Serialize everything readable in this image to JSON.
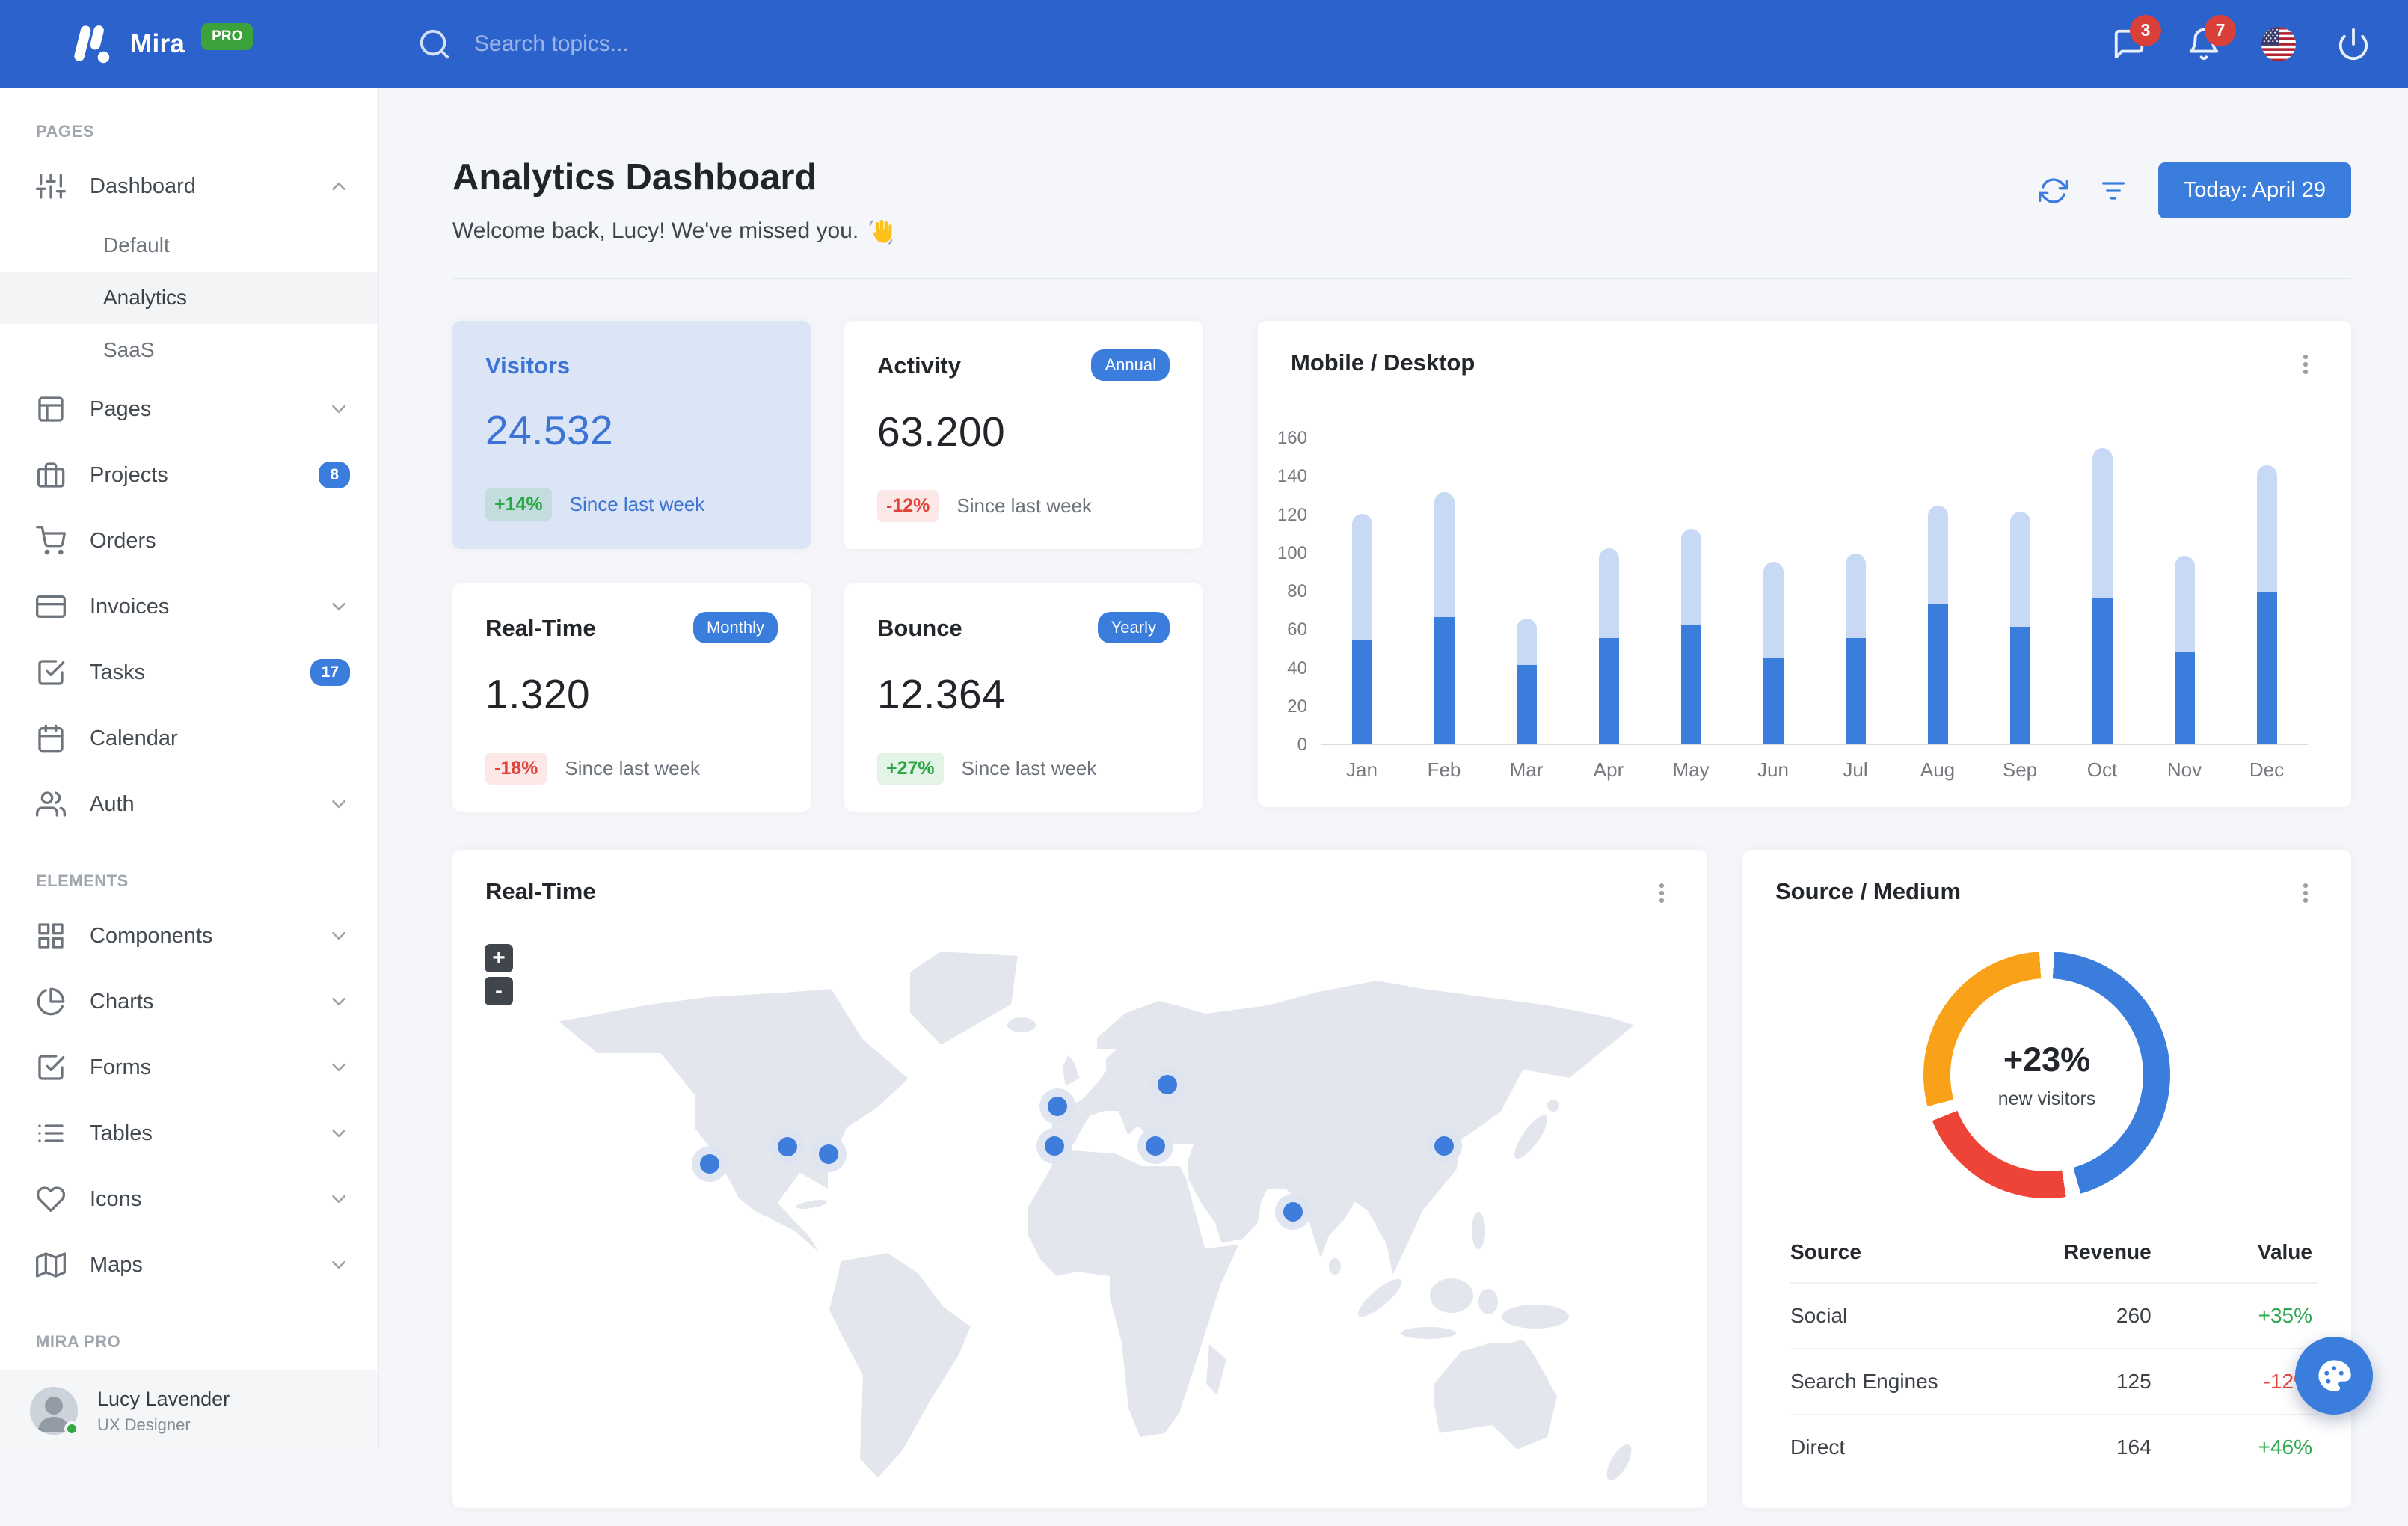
{
  "colors": {
    "navbar": "#2C62CB",
    "primary": "#3B7DDD",
    "success": "#2FA84F",
    "danger": "#E5473C",
    "warning_orange": "#F9A119",
    "bar_light": "#C7D9F4",
    "highlight_card_bg": "#DBE5F5",
    "badge_red": "#D9403A",
    "pro_green": "#3CA23C"
  },
  "navbar": {
    "brand": "Mira",
    "brand_badge": "PRO",
    "search_placeholder": "Search topics...",
    "icons": [
      {
        "name": "messages",
        "badge": "3"
      },
      {
        "name": "notifications",
        "badge": "7"
      },
      {
        "name": "language-us-flag"
      },
      {
        "name": "power"
      }
    ]
  },
  "sidebar": {
    "sections": [
      {
        "label": "PAGES",
        "items": [
          {
            "label": "Dashboard",
            "icon": "sliders",
            "expanded": true,
            "children": [
              "Default",
              "Analytics",
              "SaaS"
            ],
            "active_child": "Analytics"
          },
          {
            "label": "Pages",
            "icon": "layout",
            "chevron": true
          },
          {
            "label": "Projects",
            "icon": "briefcase",
            "badge": "8"
          },
          {
            "label": "Orders",
            "icon": "shopping-cart"
          },
          {
            "label": "Invoices",
            "icon": "credit-card",
            "chevron": true
          },
          {
            "label": "Tasks",
            "icon": "check-square",
            "badge": "17"
          },
          {
            "label": "Calendar",
            "icon": "calendar"
          },
          {
            "label": "Auth",
            "icon": "users",
            "chevron": true
          }
        ]
      },
      {
        "label": "ELEMENTS",
        "items": [
          {
            "label": "Components",
            "icon": "grid",
            "chevron": true
          },
          {
            "label": "Charts",
            "icon": "pie-chart",
            "chevron": true
          },
          {
            "label": "Forms",
            "icon": "check-square",
            "chevron": true
          },
          {
            "label": "Tables",
            "icon": "list",
            "chevron": true
          },
          {
            "label": "Icons",
            "icon": "heart",
            "chevron": true
          },
          {
            "label": "Maps",
            "icon": "map",
            "chevron": true
          }
        ]
      },
      {
        "label": "MIRA PRO",
        "items": []
      }
    ],
    "user": {
      "name": "Lucy Lavender",
      "role": "UX Designer",
      "status": "online"
    }
  },
  "header": {
    "title": "Analytics Dashboard",
    "subtitle": "Welcome back, Lucy! We've missed you.",
    "subtitle_emoji": "👋",
    "date_button": "Today: April 29"
  },
  "stats": [
    {
      "title": "Visitors",
      "value": "24.532",
      "delta": "+14%",
      "delta_dir": "up",
      "caption": "Since last week",
      "highlight": true
    },
    {
      "title": "Activity",
      "badge": "Annual",
      "value": "63.200",
      "delta": "-12%",
      "delta_dir": "down",
      "caption": "Since last week"
    },
    {
      "title": "Real-Time",
      "badge": "Monthly",
      "value": "1.320",
      "delta": "-18%",
      "delta_dir": "down",
      "caption": "Since last week"
    },
    {
      "title": "Bounce",
      "badge": "Yearly",
      "value": "12.364",
      "delta": "+27%",
      "delta_dir": "up",
      "caption": "Since last week"
    }
  ],
  "chart_data": [
    {
      "type": "bar",
      "title": "Mobile / Desktop",
      "stacked": true,
      "categories": [
        "Jan",
        "Feb",
        "Mar",
        "Apr",
        "May",
        "Jun",
        "Jul",
        "Aug",
        "Sep",
        "Oct",
        "Nov",
        "Dec"
      ],
      "series": [
        {
          "name": "Mobile",
          "color": "#3B7DDD",
          "values": [
            54,
            66,
            41,
            55,
            62,
            45,
            55,
            73,
            61,
            76,
            48,
            79
          ]
        },
        {
          "name": "Desktop",
          "color": "#C7D9F4",
          "values": [
            66,
            65,
            24,
            47,
            50,
            50,
            44,
            51,
            60,
            78,
            50,
            66
          ]
        }
      ],
      "ylim": [
        0,
        160
      ],
      "yticks": [
        0,
        20,
        40,
        60,
        80,
        100,
        120,
        140,
        160
      ],
      "grid": false,
      "legend": "none"
    },
    {
      "type": "donut",
      "title": "Source / Medium",
      "center_value": "+23%",
      "center_label": "new visitors",
      "segments": [
        {
          "label": "Social",
          "value": 260,
          "color": "#3B7DDD"
        },
        {
          "label": "Search Engines",
          "value": 125,
          "color": "#EE4437"
        },
        {
          "label": "Direct",
          "value": 164,
          "color": "#F9A119"
        }
      ]
    }
  ],
  "map": {
    "title": "Real-Time",
    "zoom_in_label": "+",
    "zoom_out_label": "-",
    "markers": [
      {
        "x": 20.5,
        "y": 41.0
      },
      {
        "x": 26.7,
        "y": 38.2
      },
      {
        "x": 30.0,
        "y": 39.4
      },
      {
        "x": 48.2,
        "y": 31.6
      },
      {
        "x": 48.0,
        "y": 38.0
      },
      {
        "x": 56.0,
        "y": 38.0
      },
      {
        "x": 57.0,
        "y": 28.0
      },
      {
        "x": 67.0,
        "y": 48.8
      },
      {
        "x": 79.0,
        "y": 38.0
      }
    ]
  },
  "source_medium": {
    "title": "Source / Medium",
    "table": {
      "headers": [
        "Source",
        "Revenue",
        "Value"
      ],
      "rows": [
        {
          "source": "Social",
          "revenue": "260",
          "value": "+35%",
          "dir": "up"
        },
        {
          "source": "Search Engines",
          "revenue": "125",
          "value": "-12%",
          "dir": "down"
        },
        {
          "source": "Direct",
          "revenue": "164",
          "value": "+46%",
          "dir": "up"
        }
      ]
    }
  }
}
